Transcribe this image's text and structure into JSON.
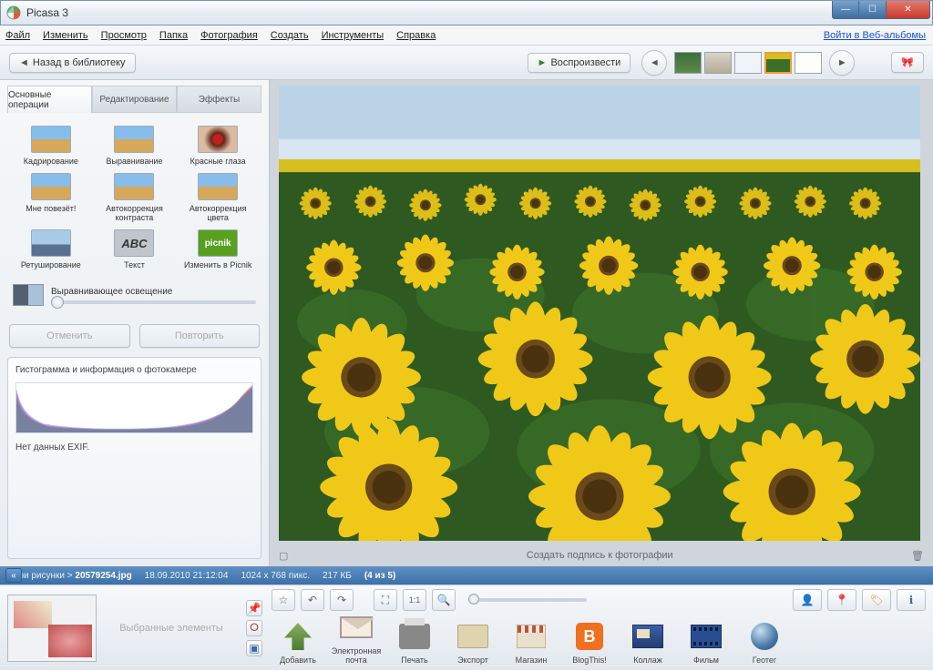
{
  "window": {
    "title": "Picasa 3"
  },
  "menu": {
    "file": "Файл",
    "edit": "Изменить",
    "view": "Просмотр",
    "folder": "Папка",
    "photo": "Фотография",
    "create": "Создать",
    "tools": "Инструменты",
    "help": "Справка",
    "web_login": "Войти в Веб-альбомы"
  },
  "toolbar": {
    "back": "Назад в библиотеку",
    "play": "Воспроизвести"
  },
  "tabs": {
    "basic": "Основные операции",
    "editing": "Редактирование",
    "effects": "Эффекты"
  },
  "tools": {
    "crop": "Кадрирование",
    "straighten": "Выравнивание",
    "redeye": "Красные глаза",
    "lucky": "Мне повезёт!",
    "contrast": "Автокоррекция контраста",
    "color": "Автокоррекция цвета",
    "retouch": "Ретуширование",
    "text": "Текст",
    "picnik": "Изменить в Picnik",
    "text_label": "ABC",
    "picnik_label": "picnik",
    "fill_light": "Выравнивающее освещение"
  },
  "undo": {
    "undo": "Отменить",
    "redo": "Повторить"
  },
  "histogram": {
    "title": "Гистограмма и информация о фотокамере",
    "exif": "Нет данных EXIF."
  },
  "caption": {
    "placeholder": "Создать подпись к фотографии"
  },
  "statusbar": {
    "folder": "Мои рисунки",
    "filename": "20579254.jpg",
    "datetime": "18.09.2010 21:12:04",
    "dims": "1024 x 768 пикс.",
    "size": "217 КБ",
    "pos": "(4 из 5)"
  },
  "tray": {
    "selected": "Выбранные элементы"
  },
  "actions": {
    "add": "Добавить",
    "email": "Электронная почта",
    "print": "Печать",
    "export": "Экспорт",
    "shop": "Магазин",
    "blog": "BlogThis!",
    "collage": "Коллаж",
    "movie": "Фильм",
    "geotag": "Геотег"
  }
}
